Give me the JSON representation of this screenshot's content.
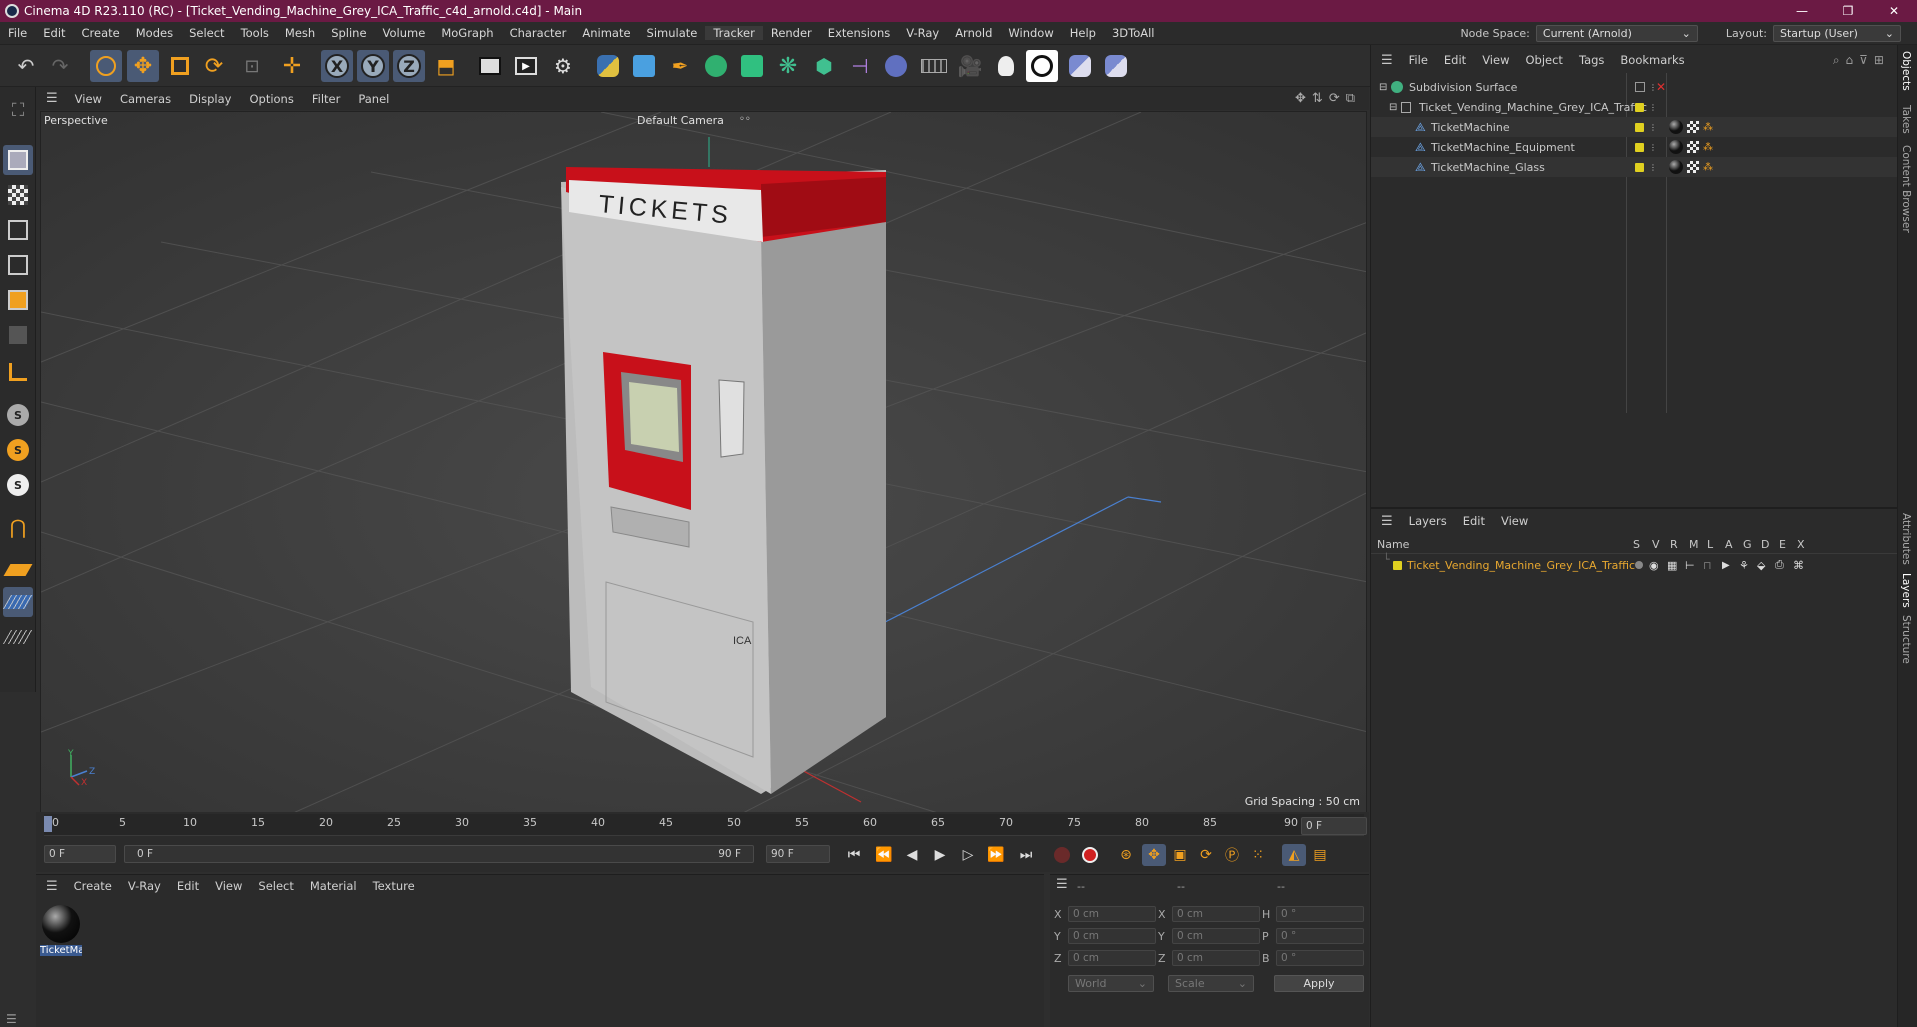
{
  "window": {
    "title": "Cinema 4D R23.110 (RC) - [Ticket_Vending_Machine_Grey_ICA_Traffic_c4d_arnold.c4d] - Main",
    "minimize": "—",
    "maximize": "❐",
    "close": "✕"
  },
  "menubar": {
    "items": [
      "File",
      "Edit",
      "Create",
      "Modes",
      "Select",
      "Tools",
      "Mesh",
      "Spline",
      "Volume",
      "MoGraph",
      "Character",
      "Animate",
      "Simulate",
      "Tracker",
      "Render",
      "Extensions",
      "V-Ray",
      "Arnold",
      "Window",
      "Help",
      "3DToAll"
    ],
    "node_space_label": "Node Space:",
    "node_space_value": "Current (Arnold)",
    "layout_label": "Layout:",
    "layout_value": "Startup (User)"
  },
  "viewport": {
    "menu": [
      "View",
      "Cameras",
      "Display",
      "Options",
      "Filter",
      "Panel"
    ],
    "view_name": "Perspective",
    "camera": "Default Camera",
    "grid_spacing": "Grid Spacing : 50 cm",
    "model_text": "TICKETS",
    "model_logo": "ICA",
    "axis_x": "X",
    "axis_y": "Y",
    "axis_z": "Z"
  },
  "timeline": {
    "ticks": [
      "0",
      "5",
      "10",
      "15",
      "20",
      "25",
      "30",
      "35",
      "40",
      "45",
      "50",
      "55",
      "60",
      "65",
      "70",
      "75",
      "80",
      "85",
      "90"
    ],
    "current_frame_right": "0 F",
    "start_field": "0 F",
    "range_start": "0 F",
    "range_end": "90 F",
    "end_field": "90 F"
  },
  "material_panel": {
    "menu": [
      "Create",
      "V-Ray",
      "Edit",
      "View",
      "Select",
      "Material",
      "Texture"
    ],
    "material_name": "TicketMa"
  },
  "coordinates": {
    "header": [
      "--",
      "--",
      "--"
    ],
    "rows": [
      {
        "a": "X",
        "av": "0 cm",
        "b": "X",
        "bv": "0 cm",
        "c": "H",
        "cv": "0 °"
      },
      {
        "a": "Y",
        "av": "0 cm",
        "b": "Y",
        "bv": "0 cm",
        "c": "P",
        "cv": "0 °"
      },
      {
        "a": "Z",
        "av": "0 cm",
        "b": "Z",
        "bv": "0 cm",
        "c": "B",
        "cv": "0 °"
      }
    ],
    "space": "World",
    "mode": "Scale",
    "apply": "Apply"
  },
  "objects_panel": {
    "menu": [
      "File",
      "Edit",
      "View",
      "Object",
      "Tags",
      "Bookmarks"
    ],
    "items": [
      {
        "name": "Subdivision Surface",
        "level": 0
      },
      {
        "name": "Ticket_Vending_Machine_Grey_ICA_Traffic",
        "level": 1
      },
      {
        "name": "TicketMachine",
        "level": 2
      },
      {
        "name": "TicketMachine_Equipment",
        "level": 2
      },
      {
        "name": "TicketMachine_Glass",
        "level": 2
      }
    ]
  },
  "layers_panel": {
    "menu": [
      "Layers",
      "Edit",
      "View"
    ],
    "columns": [
      "Name",
      "S",
      "V",
      "R",
      "M",
      "L",
      "A",
      "G",
      "D",
      "E",
      "X"
    ],
    "layer_name": "Ticket_Vending_Machine_Grey_ICA_Traffic",
    "layer_color": "#e0c020"
  },
  "side_tabs": [
    "Objects",
    "Takes",
    "Content Browser",
    "Attributes",
    "Layers",
    "Structure"
  ],
  "colors": {
    "titlebar": "#6b1a44",
    "accent": "#4a5a75",
    "machine_red": "#c8101a",
    "layer_text": "#e8a830"
  }
}
